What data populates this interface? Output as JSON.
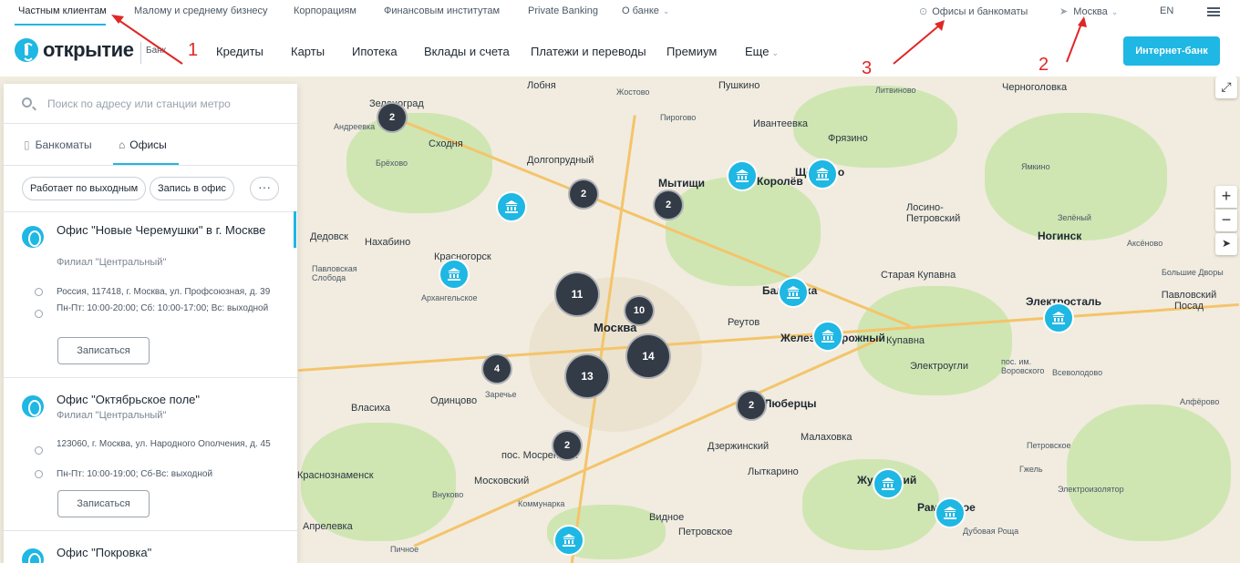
{
  "topbar": {
    "segments": [
      "Частным клиентам",
      "Малому и среднему бизнесу",
      "Корпорациям",
      "Финансовым институтам",
      "Private Banking",
      "О банке"
    ],
    "offices": "Офисы и банкоматы",
    "city": "Москва",
    "lang": "EN"
  },
  "header": {
    "brand": "открытие",
    "brand_sub": "Банк",
    "nav": [
      "Кредиты",
      "Карты",
      "Ипотека",
      "Вклады и счета",
      "Платежи и переводы",
      "Премиум",
      "Еще"
    ],
    "internet_bank": "Интернет-банк"
  },
  "annotations": [
    "1",
    "2",
    "3"
  ],
  "panel": {
    "search_placeholder": "Поиск по адресу или станции метро",
    "tabs": [
      "Банкоматы",
      "Офисы"
    ],
    "active_tab": "Офисы",
    "chips": [
      "Работает по выходным",
      "Запись в офис"
    ],
    "more": "···",
    "offices": [
      {
        "title": "Офис \"Новые Черемушки\" в г. Москве",
        "branch": "Филиал \"Центральный\"",
        "address": "Россия, 117418, г. Москва, ул. Профсоюзная, д. 39",
        "hours": "Пн-Пт: 10:00-20:00; Сб: 10:00-17:00; Вс: выходной",
        "button": "Записаться"
      },
      {
        "title": "Офис \"Октябрьское поле\"",
        "branch": "Филиал \"Центральный\"",
        "address": "123060, г. Москва, ул. Народного Ополчения, д. 45",
        "hours": "Пн-Пт: 10:00-19:00; Сб-Вс: выходной",
        "button": "Записаться"
      },
      {
        "title": "Офис \"Покровка\""
      }
    ]
  },
  "map": {
    "clusters": [
      "2",
      "2",
      "2",
      "11",
      "10",
      "14",
      "4",
      "13",
      "2",
      "2"
    ],
    "labels": [
      "Зеленоград",
      "Андреевка",
      "Сходня",
      "Лобня",
      "Пушкино",
      "Ивантеевка",
      "Фрязино",
      "Долгопрудный",
      "Мытищи",
      "Королёв",
      "Щёлково",
      "Лосино-Петровский",
      "Черноголовка",
      "Литвиново",
      "Дедовск",
      "Нахабино",
      "Красногорск",
      "Архангельское",
      "Москва",
      "Реутов",
      "Балашиха",
      "Железнодорожный",
      "Купавна",
      "Старая Купавна",
      "Ногинск",
      "Электросталь",
      "Павловский Посад",
      "Электроугли",
      "Одинцово",
      "Власиха",
      "Заречье",
      "Люберцы",
      "Малаховка",
      "Дзержинский",
      "Лыткарино",
      "Жуковский",
      "Раменское",
      "Московский",
      "пос. Мосрентген",
      "Апрелевка",
      "Внуково",
      "Видное",
      "Петровское",
      "Коммунарка",
      "Краснознаменск",
      "Брёхово",
      "Ямкино",
      "Всеволодово",
      "Зелёный",
      "Большие Дворы",
      "Аксёново",
      "Гжель",
      "Электроизолятор",
      "Дубовая Роща",
      "Пичное",
      "Петровское",
      "Жостово",
      "Пирогово",
      "Алфёрово",
      "Павловская Слобода",
      "пос. им. Воровского"
    ],
    "zoom_in": "+",
    "zoom_out": "−"
  }
}
